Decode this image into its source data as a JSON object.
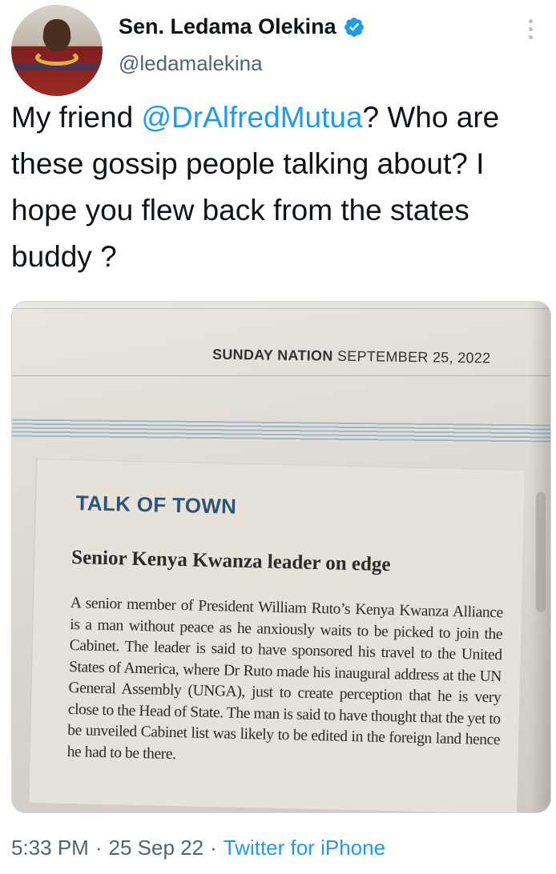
{
  "author": {
    "display_name": "Sen. Ledama Olekina",
    "handle": "@ledamalekina",
    "verified_icon": "verified-badge-icon"
  },
  "tweet": {
    "text_before": "My friend ",
    "mention": "@DrAlfredMutua",
    "text_after": "? Who are these gossip people talking about? I hope you flew back from the states buddy ?"
  },
  "newspaper": {
    "paper_name": "SUNDAY NATION",
    "date": "SEPTEMBER 25, 2022",
    "section": "TALK OF TOWN",
    "headline": "Senior Kenya Kwanza leader on edge",
    "body": "A senior member of President William Ruto’s Kenya Kwanza Alliance is a man without peace as he anxiously waits to be picked to join the Cabinet. The leader is said to have sponsored his travel to the United States of America, where Dr Ruto made his inaugural address at the UN General Assembly (UNGA), just to create perception that he is very close to the Head of State. The man is said to have thought that the yet to be unveiled Cabinet list was likely to be edited in the foreign land hence he had to be there."
  },
  "meta": {
    "time": "5:33 PM",
    "separator": "·",
    "date": "25 Sep 22",
    "source": "Twitter for iPhone"
  },
  "colors": {
    "text": "#0f1419",
    "secondary": "#536471",
    "link": "#1d9bf0",
    "verified": "#1d9bf0"
  }
}
